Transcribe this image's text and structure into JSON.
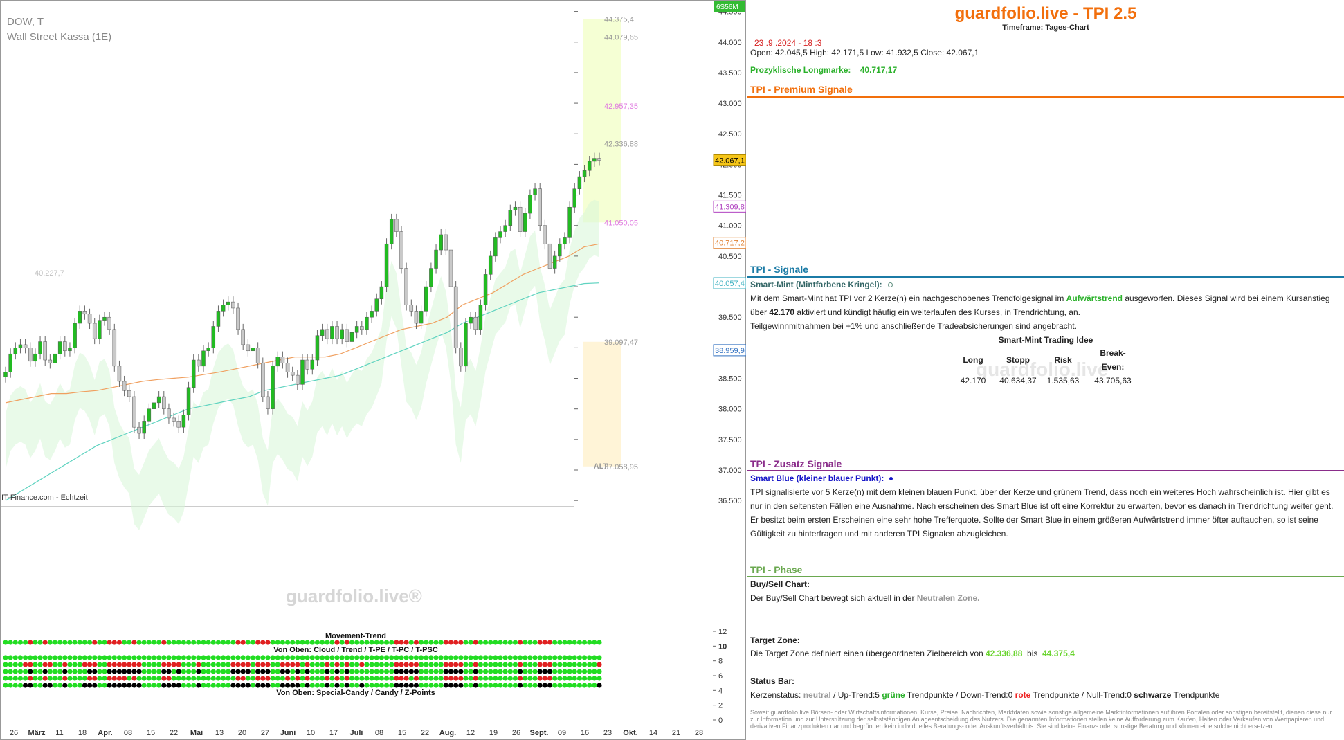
{
  "chart_header": {
    "symbol": "DOW, T",
    "name": "Wall Street Kassa (1E)",
    "source": "IT-Finance.com - Echtzeit",
    "watermark": "guardfolio.live®",
    "badge": "6S56M",
    "zone_label": "ALT",
    "movement_title": "Movement-Trend",
    "top_rows_title": "Von Oben: Cloud / Trend / T-PE / T-PC / T-PSC",
    "bottom_rows_title": "Von Oben: Special-Candy / Candy / Z-Points"
  },
  "colors": {
    "accent_orange": "#f26f0c",
    "signal_teal": "#1b7ba6",
    "zusatz_purple": "#8a2d8a",
    "phase_green": "#6aa84f",
    "bull_candle": "#22bb22",
    "bear_candle": "#c9c9c9",
    "up_candle": "#e8c060",
    "cloud": "#d7f5d7",
    "zone_green": "#f3ffcc",
    "zone_orange": "#fff2d0",
    "box": "#9a9af0",
    "ema_orange": "#f0a060",
    "ema_teal": "#5fd3c0"
  },
  "chart_data": {
    "type": "candlestick",
    "title": "DOW, T",
    "subtitle": "Wall Street Kassa (1E)",
    "y_axis": {
      "ticks": [
        "44.500",
        "44.000",
        "43.500",
        "43.000",
        "42.500",
        "42.000",
        "41.500",
        "41.000",
        "40.500",
        "40.000",
        "39.500",
        "39.000",
        "38.500",
        "38.000",
        "37.500",
        "37.000",
        "36.500"
      ],
      "tick_values": [
        44500,
        44000,
        43500,
        43000,
        42500,
        42000,
        41500,
        41000,
        40500,
        40000,
        39500,
        39000,
        38500,
        38000,
        37500,
        37000,
        36500
      ],
      "ylim": [
        36400,
        44620
      ]
    },
    "x_axis": {
      "ticks": [
        "26",
        "März",
        "11",
        "18",
        "Apr.",
        "08",
        "15",
        "22",
        "Mai",
        "13",
        "20",
        "27",
        "Juni",
        "10",
        "17",
        "Juli",
        "08",
        "15",
        "22",
        "Aug.",
        "12",
        "19",
        "26",
        "Sept.",
        "09",
        "16",
        "23",
        "Okt.",
        "14",
        "21",
        "28"
      ],
      "bold_ticks": [
        "März",
        "Apr.",
        "Mai",
        "Juni",
        "Juli",
        "Aug.",
        "Sept.",
        "Okt."
      ]
    },
    "price_labels": [
      {
        "label": "42.067,1",
        "value": 42067,
        "style": "current"
      },
      {
        "label": "41.309,8",
        "value": 41310,
        "style": "purple"
      },
      {
        "label": "40.717,2",
        "value": 40717,
        "style": "orange"
      },
      {
        "label": "40.057,4",
        "value": 40057,
        "style": "teal"
      },
      {
        "label": "38.959,9",
        "value": 38960,
        "style": "blue"
      }
    ],
    "zone_levels": [
      {
        "label": "44.375,4",
        "value": 44375,
        "color": "#999999"
      },
      {
        "label": "44.079,65",
        "value": 44080,
        "color": "#999999"
      },
      {
        "label": "42.957,35",
        "value": 42957,
        "color": "#e07ae0"
      },
      {
        "label": "42.336,88",
        "value": 42337,
        "color": "#999999"
      },
      {
        "label": "41.050,05",
        "value": 41050,
        "color": "#e07ae0"
      },
      {
        "label": "39.097,47",
        "value": 39097,
        "color": "#999999"
      },
      {
        "label": "37.058,95",
        "value": 37059,
        "color": "#999999"
      },
      {
        "label": "40.227,7",
        "value": 40228,
        "color": "#c0c0c0"
      }
    ],
    "candles_close": [
      38600,
      38900,
      39000,
      39050,
      39000,
      38780,
      38900,
      39100,
      38800,
      38750,
      38900,
      39100,
      38950,
      39000,
      39400,
      39600,
      39550,
      39400,
      39150,
      39450,
      39500,
      39300,
      38700,
      38450,
      38300,
      38200,
      37700,
      37600,
      37800,
      38000,
      38100,
      38200,
      38000,
      37850,
      37800,
      37700,
      37900,
      38350,
      38800,
      38700,
      38950,
      39000,
      39350,
      39600,
      39700,
      39750,
      39650,
      39300,
      39050,
      38950,
      39000,
      38750,
      38200,
      38000,
      38700,
      38850,
      38750,
      38600,
      38550,
      38400,
      38800,
      38650,
      38800,
      39200,
      39300,
      39150,
      39350,
      39150,
      39300,
      39100,
      39250,
      39350,
      39300,
      39500,
      39600,
      39800,
      40000,
      40700,
      41100,
      40900,
      40300,
      39700,
      39600,
      39400,
      39600,
      40000,
      40300,
      40600,
      40850,
      40600,
      40000,
      39000,
      38700,
      39400,
      39500,
      39300,
      39700,
      40200,
      40500,
      40800,
      40900,
      41000,
      41250,
      41300,
      40900,
      41200,
      41500,
      41600,
      41000,
      40700,
      40300,
      40500,
      40700,
      40800,
      41300,
      41600,
      41800,
      41900,
      42050,
      42100,
      42067
    ],
    "ema_series": [
      {
        "name": "",
        "color": "#f0a060",
        "values": [
          38100,
          38150,
          38200,
          38250,
          38250,
          38280,
          38300,
          38350,
          38400,
          38450,
          38480,
          38500,
          38520,
          38560,
          38600,
          38650,
          38700,
          38750,
          38800,
          38850,
          38850,
          38850,
          38900,
          39000,
          39100,
          39200,
          39300,
          39350,
          39400,
          39500,
          39700,
          39800,
          39900,
          40050,
          40200,
          40300,
          40400,
          40500,
          40650,
          40700
        ]
      },
      {
        "name": "",
        "color": "#5fd3c0",
        "values": [
          36500,
          36650,
          36800,
          36950,
          37100,
          37250,
          37400,
          37500,
          37600,
          37700,
          37800,
          37900,
          38000,
          38050,
          38100,
          38150,
          38200,
          38300,
          38350,
          38400,
          38450,
          38500,
          38550,
          38650,
          38750,
          38850,
          38950,
          39050,
          39150,
          39250,
          39400,
          39500,
          39600,
          39700,
          39800,
          39900,
          39950,
          40000,
          40050,
          40060
        ]
      }
    ],
    "grid": false,
    "legend": "none",
    "indicator_panel": {
      "y_ticks": [
        "12",
        "10",
        "8",
        "6",
        "4",
        "2",
        "0"
      ],
      "y_tick_values": [
        12,
        10,
        8,
        6,
        4,
        2,
        0
      ],
      "bold_tick": "10"
    }
  },
  "tpi": {
    "title": "guardfolio.live - TPI 2.5",
    "timeframe": "Timeframe: Tages-Chart",
    "datetime": "23 .9 .2024  - 18 :3",
    "ohlc": "Open: 42.045,5     High:  42.171,5     Low:   41.932,5     Close: 42.067,1",
    "longmarke_label": "Prozyklische Longmarke:",
    "longmarke_value": "40.717,17",
    "premium_title": "TPI - Premium Signale",
    "signale_title": "TPI - Signale",
    "smart_mint_head": "Smart-Mint (Mintfarbene Kringel):",
    "smart_mint_p1a": "Mit dem Smart-Mint hat TPI vor 2  Kerze(n) ein nachgeschobenes Trendfolgesignal im ",
    "smart_mint_trend": "Aufwärtstrend",
    "smart_mint_p1b": " ausgeworfen. Dieses Signal wird bei einem Kursanstieg über ",
    "smart_mint_level": "42.170",
    "smart_mint_p1c": "      aktiviert und kündigt häufig ein weiterlaufen des Kurses, in Trendrichtung, an.",
    "smart_mint_p2": "Teilgewinnmitnahmen bei +1% und anschließende Tradeabsicherungen sind angebracht.",
    "idea_title": "Smart-Mint Trading Idee",
    "idea_headers": [
      "Long",
      "Stopp",
      "Risk",
      "Break-Even:"
    ],
    "idea_values": [
      "42.170",
      "40.634,37",
      "1.535,63",
      "43.705,63"
    ],
    "watermark": "guardfolio.live",
    "zusatz_title": "TPI - Zusatz Signale",
    "smart_blue_head": "Smart Blue (kleiner blauer Punkt):",
    "smart_blue_text": "TPI signalisierte vor 5  Kerze(n) mit dem kleinen blauen Punkt, über der Kerze und grünem Trend, dass noch ein weiteres Hoch wahrscheinlich ist. Hier gibt es nur in den seltensten Fällen eine Ausnahme. Nach erscheinen des Smart Blue ist oft eine Korrektur zu erwarten, bevor es danach in Trendrichtung weiter geht. Er besitzt beim ersten Erscheinen eine sehr hohe Trefferquote. Sollte der Smart Blue in einem größeren Aufwärtstrend immer öfter auftauchen, so ist seine Gültigkeit zu hinterfragen und mit anderen TPI Signalen abzugleichen.",
    "phase_title": "TPI - Phase",
    "buysell_head": "Buy/Sell Chart:",
    "buysell_text": "Der Buy/Sell Chart bewegt sich aktuell in der ",
    "buysell_zone": "Neutralen Zone.",
    "target_head": "Target Zone:",
    "target_text": "Die Target Zone definiert einen übergeordneten Zielbereich von ",
    "target_low": "42.336,88",
    "target_mid": "  bis  ",
    "target_high": "44.375,4",
    "status_head": "Status Bar:",
    "status_a": "Kerzenstatus: ",
    "status_neutral": "neutral",
    "status_b": "  / Up-Trend:5 ",
    "status_green": "grüne",
    "status_c": " Trendpunkte  / Down-Trend:0 ",
    "status_red": "rote",
    "status_d": " Trendpunkte / Null-Trend:0 ",
    "status_black": "schwarze",
    "status_e": " Trendpunkte",
    "disclaimer": "Soweit guardfolio live Börsen- oder Wirtschaftsinformationen, Kurse, Preise, Nachrichten, Marktdaten sowie sonstige allgemeine Marktinformationen auf ihren Portalen oder sonstigen bereitstellt, dienen diese nur zur Information und zur Unterstützung der selbstständigen Anlageentscheidung des Nutzers. Die genannten Informationen stellen keine Aufforderung zum Kaufen, Halten oder Verkaufen von Wertpapieren und derivativen Finanzprodukten dar und begründen kein individuelles Beratungs- oder Auskunftsverhältnis. Sie sind keine Finanz- oder sonstige Beratung und können eine solche nicht ersetzen."
  }
}
